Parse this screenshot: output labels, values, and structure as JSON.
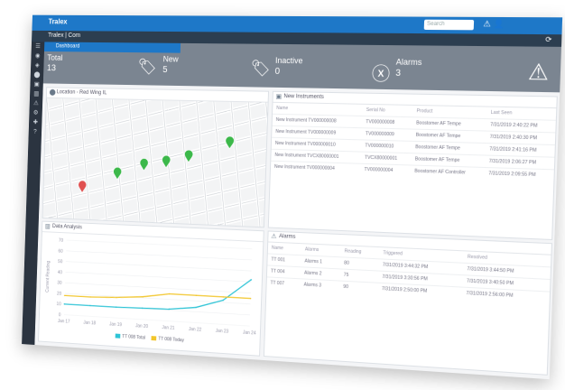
{
  "window": {
    "title": "Tralex",
    "app_name": "Tralex | Com",
    "search_placeholder": "Search"
  },
  "dashboard_tab": "Dashboard",
  "stats": [
    {
      "label": "Total",
      "value": "13"
    },
    {
      "label": "New",
      "value": "5"
    },
    {
      "label": "Inactive",
      "value": "0"
    },
    {
      "label": "Alarms",
      "value": "3"
    }
  ],
  "map_panel": {
    "title": "Location - Red Wing IL"
  },
  "instruments_panel": {
    "title": "New Instruments",
    "columns": [
      "Name",
      "Serial No",
      "Product",
      "Last Seen"
    ],
    "rows": [
      [
        "New Instrument TV000000008",
        "TV000000008",
        "Boostomer AF Tempe",
        "7/31/2019 2:40:22 PM"
      ],
      [
        "New Instrument TV000000009",
        "TV000000009",
        "Boostomer AF Tempe",
        "7/31/2019 2:40:30 PM"
      ],
      [
        "New Instrument TV000000010",
        "TV000000010",
        "Boostomer AF Tempe",
        "7/31/2019 2:41:16 PM"
      ],
      [
        "New Instrument TVCX80000001",
        "TVCX80000001",
        "Boostomer AF Tempe",
        "7/31/2019 2:06:27 PM"
      ],
      [
        "New Instrument TV000000004",
        "TV000000004",
        "Boostomer AF Controller",
        "7/31/2019 2:09:55 PM"
      ]
    ]
  },
  "data_panel": {
    "title": "Data Analysis"
  },
  "alarms_panel": {
    "title": "Alarms",
    "columns": [
      "Name",
      "Alarms",
      "Reading",
      "Triggered",
      "Resolved"
    ],
    "rows": [
      [
        "TT 001",
        "Alarms 1",
        "80",
        "7/31/2019 3:44:32 PM",
        "7/31/2019 3:44:50 PM"
      ],
      [
        "TT 004",
        "Alarms 2",
        "75",
        "7/31/2019 3:30:56 PM",
        "7/31/2019 3:40:50 PM"
      ],
      [
        "TT 007",
        "Alarms 3",
        "90",
        "7/31/2019 2:50:00 PM",
        "7/31/2019 2:56:00 PM"
      ]
    ]
  },
  "chart_data": {
    "type": "line",
    "x": [
      "Jan 17",
      "Jan 18",
      "Jan 19",
      "Jan 20",
      "Jan 21",
      "Jan 22",
      "Jan 23",
      "Jan 24"
    ],
    "ylabel": "Current Reading",
    "yticks": [
      "0",
      "10",
      "20",
      "30",
      "40",
      "50",
      "60",
      "70"
    ],
    "ylim": [
      0,
      70
    ],
    "series": [
      {
        "name": "TT 008 Total",
        "color": "#2ec4d6",
        "values": [
          10,
          10,
          10,
          10.5,
          11,
          14,
          22,
          42
        ]
      },
      {
        "name": "TT 008 Today",
        "color": "#f2c62c",
        "values": [
          18,
          18,
          19,
          21,
          25,
          25,
          25,
          25
        ]
      }
    ],
    "grid": true,
    "legend": "bottom"
  },
  "map_pins": [
    {
      "color": "#e05050",
      "row": 0.78,
      "col": 0.18
    },
    {
      "color": "#3cb84a",
      "row": 0.66,
      "col": 0.34
    },
    {
      "color": "#3cb84a",
      "row": 0.58,
      "col": 0.46
    },
    {
      "color": "#3cb84a",
      "row": 0.55,
      "col": 0.56
    },
    {
      "color": "#3cb84a",
      "row": 0.5,
      "col": 0.66
    },
    {
      "color": "#3cb84a",
      "row": 0.38,
      "col": 0.84
    }
  ]
}
